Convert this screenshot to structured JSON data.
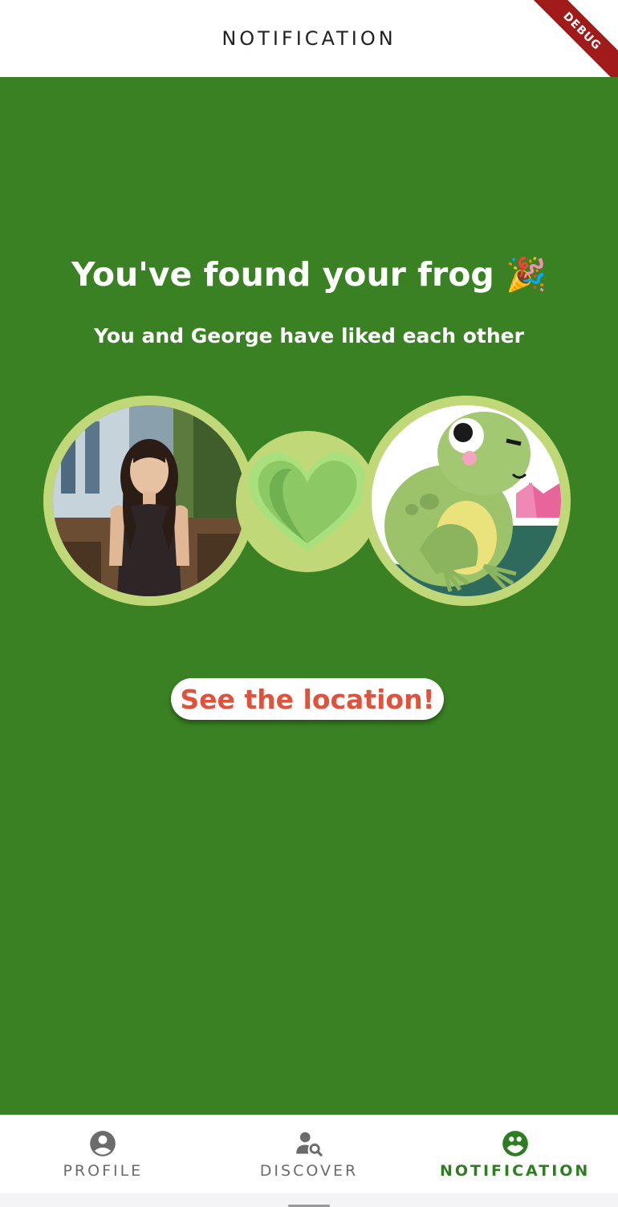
{
  "appbar": {
    "title": "NOTIFICATION"
  },
  "debug_banner": "DEBUG",
  "match": {
    "headline": "You've found your frog 🎉",
    "subtitle": "You and George have liked each other",
    "cta_label": "See the location!"
  },
  "bottom_nav": {
    "items": [
      {
        "label": "PROFILE",
        "icon": "account-circle-icon",
        "active": false
      },
      {
        "label": "DISCOVER",
        "icon": "person-search-icon",
        "active": false
      },
      {
        "label": "NOTIFICATION",
        "icon": "group-emoji-icon",
        "active": true
      }
    ]
  },
  "colors": {
    "background_green": "#398122",
    "ring": "#c1d879",
    "heart_light": "#8cc964",
    "heart_dark": "#6fb050",
    "cta_text": "#e0523b",
    "active_nav": "#2e7d22",
    "inactive_nav": "#6b6b6b"
  }
}
